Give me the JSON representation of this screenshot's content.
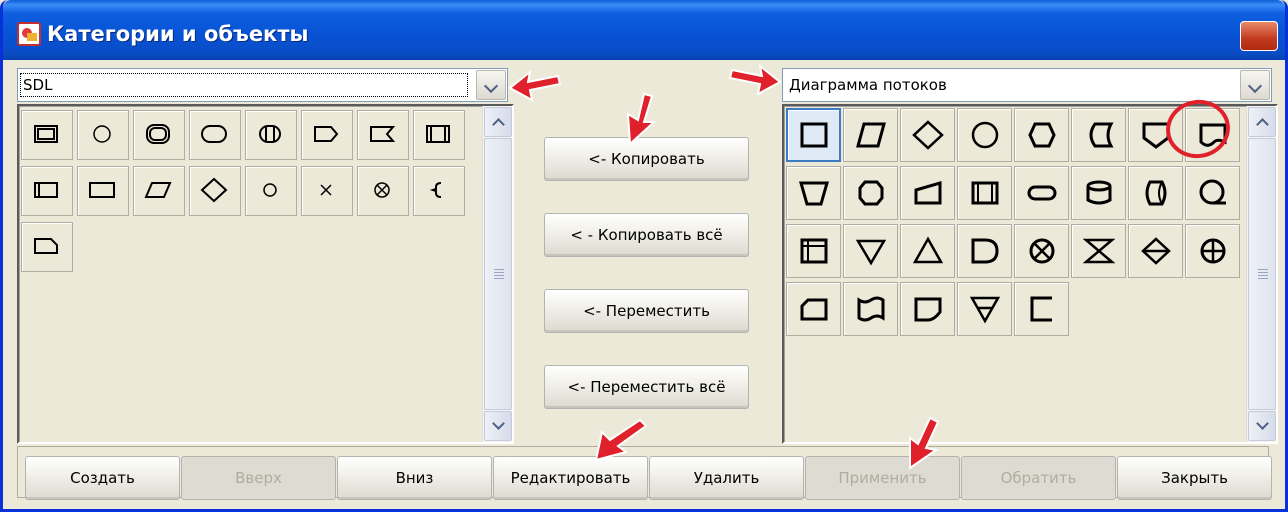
{
  "window": {
    "title": "Категории и объекты"
  },
  "left_combo": {
    "value": "SDL"
  },
  "right_combo": {
    "value": "Диаграмма потоков"
  },
  "middle_buttons": {
    "copy": "<- Копировать",
    "copy_all": "< - Копировать всё",
    "move": "<- Переместить",
    "move_all": "<- Переместить всё"
  },
  "bottom_buttons": [
    {
      "label": "Создать",
      "enabled": true
    },
    {
      "label": "Вверх",
      "enabled": false
    },
    {
      "label": "Вниз",
      "enabled": true
    },
    {
      "label": "Редактировать",
      "enabled": true
    },
    {
      "label": "Удалить",
      "enabled": true
    },
    {
      "label": "Применить",
      "enabled": false
    },
    {
      "label": "Обратить",
      "enabled": false
    },
    {
      "label": "Закрыть",
      "enabled": true
    }
  ],
  "left_icons": [
    "double-rect-icon",
    "circle-icon",
    "double-rounded-rect-icon",
    "rounded-rect-icon",
    "circle-in-rect-icon",
    "send-signal-icon",
    "receive-signal-icon",
    "procedure-icon",
    "task-rect-icon",
    "rect-icon",
    "parallelogram-icon",
    "diamond-icon",
    "small-circle-icon",
    "cross-icon",
    "circled-x-icon",
    "brace-icon",
    "note-icon"
  ],
  "right_icons": [
    "process-icon",
    "data-icon",
    "decision-icon",
    "connector-icon",
    "preparation-icon",
    "stored-data-icon",
    "offpage-connector-icon",
    "document-icon",
    "manual-operation-icon",
    "hexagon-icon",
    "manual-input-icon",
    "predefined-process-icon",
    "terminator-icon",
    "database-icon",
    "direct-access-storage-icon",
    "sequential-data-icon",
    "internal-storage-icon",
    "merge-icon",
    "extract-icon",
    "delay-icon",
    "summing-junction-icon",
    "collate-icon",
    "sort-icon",
    "or-icon",
    "card-icon",
    "punched-tape-icon",
    "display-icon",
    "offline-storage-icon",
    "annotation-icon"
  ],
  "colors": {
    "title_bar": "#0752d4",
    "annotation_red": "#e0202a",
    "selection": "#3d7bc4"
  }
}
